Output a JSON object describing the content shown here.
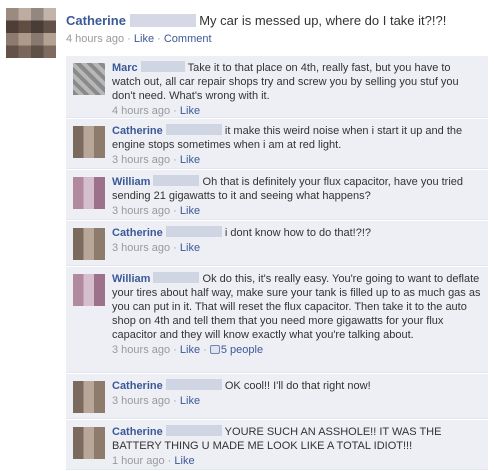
{
  "post": {
    "author": "Catherine",
    "text": "My car is messed up, where do I take it?!?!",
    "time": "4 hours ago",
    "sep1": " · ",
    "like": "Like",
    "sep2": " · ",
    "comment": "Comment"
  },
  "comments": [
    {
      "author": "Marc",
      "text": "Take it to that place on 4th, really fast, but you have to watch out, all car repair shops try and screw you by selling you stuf you don't need. What's wrong with it.",
      "time": "4 hours ago",
      "like": "Like"
    },
    {
      "author": "Catherine",
      "text": "it make this weird noise when i start it up and the engine stops sometimes when i am at red light.",
      "time": "3 hours ago",
      "like": "Like"
    },
    {
      "author": "William",
      "text": "Oh that is definitely your flux capacitor, have you tried sending 21 gigawatts to it and seeing what happens?",
      "time": "3 hours ago",
      "like": "Like"
    },
    {
      "author": "Catherine",
      "text": "i dont know how to do that!?!?",
      "time": "3 hours ago",
      "like": "Like"
    },
    {
      "author": "William",
      "text": "Ok do this, it's really easy. You're going to want to deflate your tires about half way, make sure your tank is filled up to as much gas as you can put in it. That will reset the flux capacitor. Then take it to the auto shop on 4th and tell them that you need more gigawatts for your flux capacitor and they will know exactly what you're talking about.",
      "time": "3 hours ago",
      "like": "Like",
      "likes": "5 people"
    },
    {
      "author": "Catherine",
      "text": "OK cool!! I'll do that right now!",
      "time": "3 hours ago",
      "like": "Like"
    },
    {
      "author": "Catherine",
      "text": "YOURE SUCH AN ASSHOLE!! IT WAS THE BATTERY THING U MADE ME LOOK LIKE A TOTAL IDIOT!!!",
      "time": "1 hour ago",
      "like": "Like"
    }
  ],
  "ui": {
    "dot": " · "
  }
}
